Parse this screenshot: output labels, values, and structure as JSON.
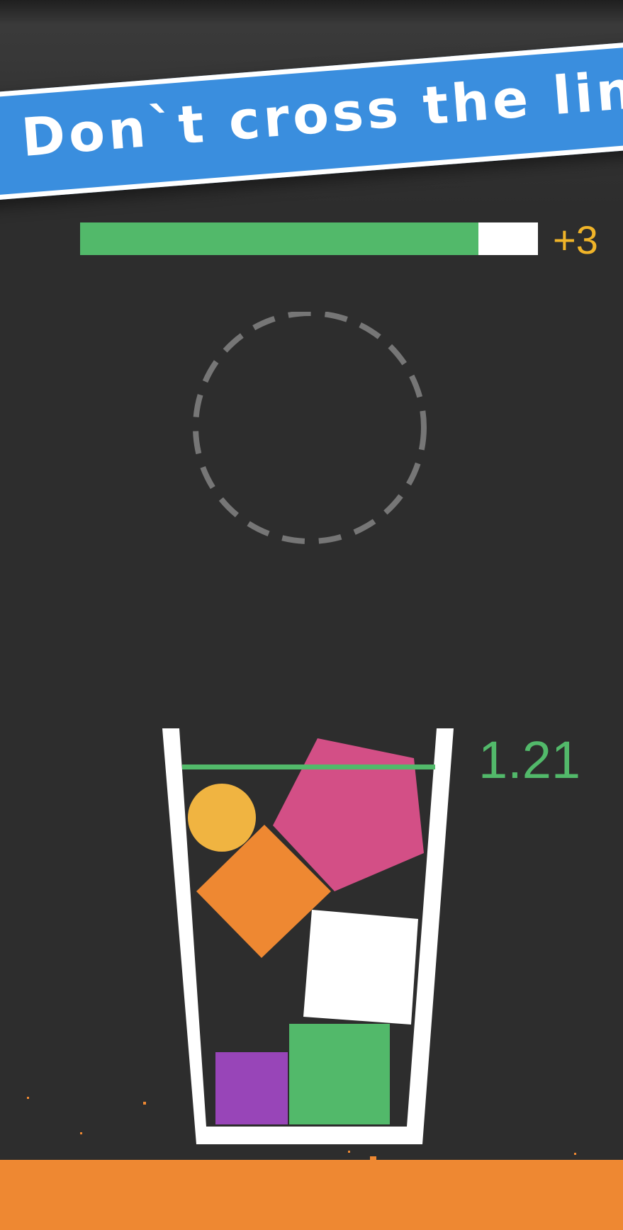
{
  "banner": {
    "text": "Don`t cross the line!"
  },
  "progress": {
    "fill_fraction": 0.87,
    "bonus_text": "+3"
  },
  "glass": {
    "height_value": "1.21"
  },
  "colors": {
    "background": "#2d2d2d",
    "banner": "#3a8ede",
    "progress_fill": "#52b96a",
    "bonus": "#f0b429",
    "line": "#52b96a",
    "ground": "#ee8832",
    "ball": "#f0b441",
    "diamond": "#ee8832",
    "pentagon": "#d34f86",
    "white_block": "#ffffff",
    "purple_block": "#9845b8",
    "green_block": "#52b96a"
  }
}
